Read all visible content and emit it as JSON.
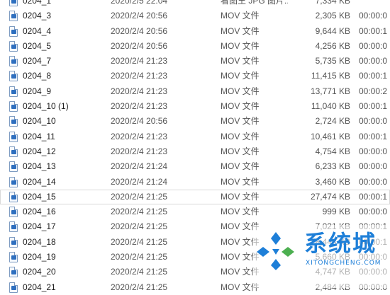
{
  "rows": [
    {
      "name": "0204_1",
      "date": "2020/2/5 22:04",
      "type": "看图王 JPG 图片...",
      "size": "7,334 KB",
      "duration": ""
    },
    {
      "name": "0204_3",
      "date": "2020/2/4 20:56",
      "type": "MOV 文件",
      "size": "2,305 KB",
      "duration": "00:00:0"
    },
    {
      "name": "0204_4",
      "date": "2020/2/4 20:56",
      "type": "MOV 文件",
      "size": "9,644 KB",
      "duration": "00:00:1"
    },
    {
      "name": "0204_5",
      "date": "2020/2/4 20:56",
      "type": "MOV 文件",
      "size": "4,256 KB",
      "duration": "00:00:0"
    },
    {
      "name": "0204_7",
      "date": "2020/2/4 21:23",
      "type": "MOV 文件",
      "size": "5,735 KB",
      "duration": "00:00:0"
    },
    {
      "name": "0204_8",
      "date": "2020/2/4 21:23",
      "type": "MOV 文件",
      "size": "11,415 KB",
      "duration": "00:00:1"
    },
    {
      "name": "0204_9",
      "date": "2020/2/4 21:23",
      "type": "MOV 文件",
      "size": "13,771 KB",
      "duration": "00:00:2"
    },
    {
      "name": "0204_10 (1)",
      "date": "2020/2/4 21:23",
      "type": "MOV 文件",
      "size": "11,040 KB",
      "duration": "00:00:1"
    },
    {
      "name": "0204_10",
      "date": "2020/2/4 20:56",
      "type": "MOV 文件",
      "size": "2,724 KB",
      "duration": "00:00:0"
    },
    {
      "name": "0204_11",
      "date": "2020/2/4 21:23",
      "type": "MOV 文件",
      "size": "10,461 KB",
      "duration": "00:00:1"
    },
    {
      "name": "0204_12",
      "date": "2020/2/4 21:23",
      "type": "MOV 文件",
      "size": "4,754 KB",
      "duration": "00:00:0"
    },
    {
      "name": "0204_13",
      "date": "2020/2/4 21:24",
      "type": "MOV 文件",
      "size": "6,233 KB",
      "duration": "00:00:0"
    },
    {
      "name": "0204_14",
      "date": "2020/2/4 21:24",
      "type": "MOV 文件",
      "size": "3,460 KB",
      "duration": "00:00:0"
    },
    {
      "name": "0204_15",
      "date": "2020/2/4 21:25",
      "type": "MOV 文件",
      "size": "27,474 KB",
      "duration": "00:00:1",
      "selected": true
    },
    {
      "name": "0204_16",
      "date": "2020/2/4 21:25",
      "type": "MOV 文件",
      "size": "999 KB",
      "duration": "00:00:0"
    },
    {
      "name": "0204_17",
      "date": "2020/2/4 21:25",
      "type": "MOV 文件",
      "size": "7,021 KB",
      "duration": "00:00:1"
    },
    {
      "name": "0204_18",
      "date": "2020/2/4 21:25",
      "type": "MOV 文件",
      "size": "8,443 KB",
      "duration": "00:00:1"
    },
    {
      "name": "0204_19",
      "date": "2020/2/4 21:25",
      "type": "MOV 文件",
      "size": "5,660 KB",
      "duration": "00:00:0"
    },
    {
      "name": "0204_20",
      "date": "2020/2/4 21:25",
      "type": "MOV 文件",
      "size": "4,747 KB",
      "duration": "00:00:0"
    },
    {
      "name": "0204_21",
      "date": "2020/2/4 21:25",
      "type": "MOV 文件",
      "size": "2,484 KB",
      "duration": "00:00:0"
    }
  ],
  "watermark": {
    "title": "系统城",
    "subtitle": "XITONGCHENG.COM",
    "colors": {
      "blue": "#1e7fd8",
      "green": "#4caf50"
    }
  }
}
